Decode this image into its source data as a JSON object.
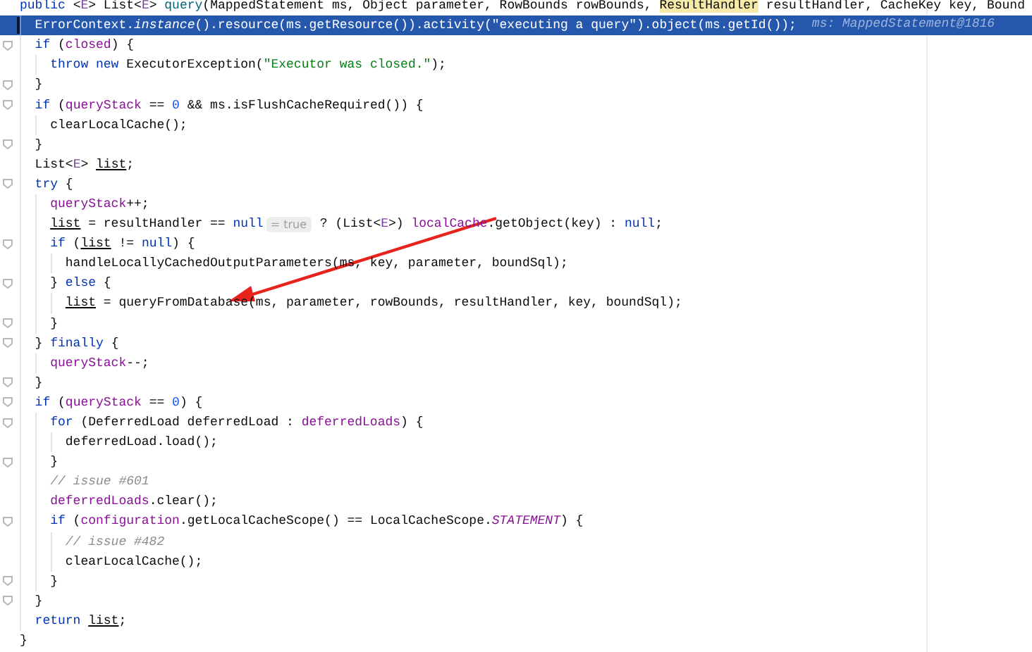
{
  "editor": {
    "lines": [
      {
        "selected": false,
        "fold": false,
        "tokens": [
          {
            "kind": "keyword",
            "text": "public "
          },
          {
            "kind": "plain",
            "text": "<"
          },
          {
            "kind": "typeparam",
            "text": "E"
          },
          {
            "kind": "plain",
            "text": "> List<"
          },
          {
            "kind": "typeparam",
            "text": "E"
          },
          {
            "kind": "plain",
            "text": "> "
          },
          {
            "kind": "method",
            "text": "query"
          },
          {
            "kind": "plain",
            "text": "(MappedStatement ms, Object parameter, RowBounds rowBounds, "
          },
          {
            "kind": "highlight",
            "text": "ResultHandler"
          },
          {
            "kind": "plain",
            "text": " resultHandler, CacheKey key, Bound"
          }
        ]
      },
      {
        "selected": true,
        "fold": false,
        "tokens": [
          {
            "kind": "plain",
            "text": "  ErrorContext."
          },
          {
            "kind": "italic",
            "text": "instance"
          },
          {
            "kind": "plain",
            "text": "().resource(ms.getResource()).activity("
          },
          {
            "kind": "string",
            "text": "\"executing a query\""
          },
          {
            "kind": "plain",
            "text": ").object(ms.getId());"
          },
          {
            "kind": "debug",
            "text": "ms: MappedStatement@1816"
          }
        ]
      },
      {
        "selected": false,
        "fold": true,
        "tokens": [
          {
            "kind": "keyword",
            "text": "  if"
          },
          {
            "kind": "plain",
            "text": " ("
          },
          {
            "kind": "field",
            "text": "closed"
          },
          {
            "kind": "plain",
            "text": ") {"
          }
        ]
      },
      {
        "selected": false,
        "fold": false,
        "tokens": [
          {
            "kind": "keyword",
            "text": "    throw new"
          },
          {
            "kind": "plain",
            "text": " ExecutorException("
          },
          {
            "kind": "string",
            "text": "\"Executor was closed.\""
          },
          {
            "kind": "plain",
            "text": ");"
          }
        ]
      },
      {
        "selected": false,
        "fold": true,
        "tokens": [
          {
            "kind": "plain",
            "text": "  }"
          }
        ]
      },
      {
        "selected": false,
        "fold": true,
        "tokens": [
          {
            "kind": "keyword",
            "text": "  if"
          },
          {
            "kind": "plain",
            "text": " ("
          },
          {
            "kind": "field",
            "text": "queryStack"
          },
          {
            "kind": "plain",
            "text": " == "
          },
          {
            "kind": "number",
            "text": "0"
          },
          {
            "kind": "plain",
            "text": " && ms.isFlushCacheRequired()) {"
          }
        ]
      },
      {
        "selected": false,
        "fold": false,
        "tokens": [
          {
            "kind": "plain",
            "text": "    clearLocalCache();"
          }
        ]
      },
      {
        "selected": false,
        "fold": true,
        "tokens": [
          {
            "kind": "plain",
            "text": "  }"
          }
        ]
      },
      {
        "selected": false,
        "fold": false,
        "tokens": [
          {
            "kind": "plain",
            "text": "  List<"
          },
          {
            "kind": "typeparam",
            "text": "E"
          },
          {
            "kind": "plain",
            "text": "> "
          },
          {
            "kind": "underlined",
            "text": "list"
          },
          {
            "kind": "plain",
            "text": ";"
          }
        ]
      },
      {
        "selected": false,
        "fold": true,
        "tokens": [
          {
            "kind": "keyword",
            "text": "  try"
          },
          {
            "kind": "plain",
            "text": " {"
          }
        ]
      },
      {
        "selected": false,
        "fold": false,
        "tokens": [
          {
            "kind": "field",
            "text": "    queryStack"
          },
          {
            "kind": "plain",
            "text": "++;"
          }
        ]
      },
      {
        "selected": false,
        "fold": false,
        "tokens": [
          {
            "kind": "underlined",
            "text": "    list"
          },
          {
            "kind": "plain",
            "text": " = resultHandler == "
          },
          {
            "kind": "keyword",
            "text": "null"
          },
          {
            "kind": "hint",
            "text": "= true"
          },
          {
            "kind": "plain",
            "text": " ? (List<"
          },
          {
            "kind": "typeparam",
            "text": "E"
          },
          {
            "kind": "plain",
            "text": ">) "
          },
          {
            "kind": "field",
            "text": "localCache"
          },
          {
            "kind": "plain",
            "text": ".getObject(key) : "
          },
          {
            "kind": "keyword",
            "text": "null"
          },
          {
            "kind": "plain",
            "text": ";"
          }
        ]
      },
      {
        "selected": false,
        "fold": true,
        "tokens": [
          {
            "kind": "keyword",
            "text": "    if"
          },
          {
            "kind": "plain",
            "text": " ("
          },
          {
            "kind": "underlined",
            "text": "list"
          },
          {
            "kind": "plain",
            "text": " != "
          },
          {
            "kind": "keyword",
            "text": "null"
          },
          {
            "kind": "plain",
            "text": ") {"
          }
        ]
      },
      {
        "selected": false,
        "fold": false,
        "tokens": [
          {
            "kind": "plain",
            "text": "      handleLocallyCachedOutputParameters(ms, key, parameter, boundSql);"
          }
        ]
      },
      {
        "selected": false,
        "fold": true,
        "tokens": [
          {
            "kind": "plain",
            "text": "    } "
          },
          {
            "kind": "keyword",
            "text": "else"
          },
          {
            "kind": "plain",
            "text": " {"
          }
        ]
      },
      {
        "selected": false,
        "fold": false,
        "tokens": [
          {
            "kind": "underlined",
            "text": "      list"
          },
          {
            "kind": "plain",
            "text": " = queryFromDatabase(ms, parameter, rowBounds, resultHandler, key, boundSql);"
          }
        ]
      },
      {
        "selected": false,
        "fold": true,
        "tokens": [
          {
            "kind": "plain",
            "text": "    }"
          }
        ]
      },
      {
        "selected": false,
        "fold": true,
        "tokens": [
          {
            "kind": "plain",
            "text": "  } "
          },
          {
            "kind": "keyword",
            "text": "finally"
          },
          {
            "kind": "plain",
            "text": " {"
          }
        ]
      },
      {
        "selected": false,
        "fold": false,
        "tokens": [
          {
            "kind": "field",
            "text": "    queryStack"
          },
          {
            "kind": "plain",
            "text": "--;"
          }
        ]
      },
      {
        "selected": false,
        "fold": true,
        "tokens": [
          {
            "kind": "plain",
            "text": "  }"
          }
        ]
      },
      {
        "selected": false,
        "fold": true,
        "tokens": [
          {
            "kind": "keyword",
            "text": "  if"
          },
          {
            "kind": "plain",
            "text": " ("
          },
          {
            "kind": "field",
            "text": "queryStack"
          },
          {
            "kind": "plain",
            "text": " == "
          },
          {
            "kind": "number",
            "text": "0"
          },
          {
            "kind": "plain",
            "text": ") {"
          }
        ]
      },
      {
        "selected": false,
        "fold": true,
        "tokens": [
          {
            "kind": "keyword",
            "text": "    for"
          },
          {
            "kind": "plain",
            "text": " (DeferredLoad deferredLoad : "
          },
          {
            "kind": "field",
            "text": "deferredLoads"
          },
          {
            "kind": "plain",
            "text": ") {"
          }
        ]
      },
      {
        "selected": false,
        "fold": false,
        "tokens": [
          {
            "kind": "plain",
            "text": "      deferredLoad.load();"
          }
        ]
      },
      {
        "selected": false,
        "fold": true,
        "tokens": [
          {
            "kind": "plain",
            "text": "    }"
          }
        ]
      },
      {
        "selected": false,
        "fold": false,
        "tokens": [
          {
            "kind": "comment",
            "text": "    // issue #601"
          }
        ]
      },
      {
        "selected": false,
        "fold": false,
        "tokens": [
          {
            "kind": "field",
            "text": "    deferredLoads"
          },
          {
            "kind": "plain",
            "text": ".clear();"
          }
        ]
      },
      {
        "selected": false,
        "fold": true,
        "tokens": [
          {
            "kind": "keyword",
            "text": "    if"
          },
          {
            "kind": "plain",
            "text": " ("
          },
          {
            "kind": "field",
            "text": "configuration"
          },
          {
            "kind": "plain",
            "text": ".getLocalCacheScope() == LocalCacheScope."
          },
          {
            "kind": "static",
            "text": "STATEMENT"
          },
          {
            "kind": "plain",
            "text": ") {"
          }
        ]
      },
      {
        "selected": false,
        "fold": false,
        "tokens": [
          {
            "kind": "comment",
            "text": "      // issue #482"
          }
        ]
      },
      {
        "selected": false,
        "fold": false,
        "tokens": [
          {
            "kind": "plain",
            "text": "      clearLocalCache();"
          }
        ]
      },
      {
        "selected": false,
        "fold": true,
        "tokens": [
          {
            "kind": "plain",
            "text": "    }"
          }
        ]
      },
      {
        "selected": false,
        "fold": true,
        "tokens": [
          {
            "kind": "plain",
            "text": "  }"
          }
        ]
      },
      {
        "selected": false,
        "fold": false,
        "tokens": [
          {
            "kind": "keyword",
            "text": "  return "
          },
          {
            "kind": "underlined",
            "text": "list"
          },
          {
            "kind": "plain",
            "text": ";"
          }
        ]
      },
      {
        "selected": false,
        "fold": false,
        "tokens": [
          {
            "kind": "plain",
            "text": "}"
          }
        ]
      }
    ]
  }
}
